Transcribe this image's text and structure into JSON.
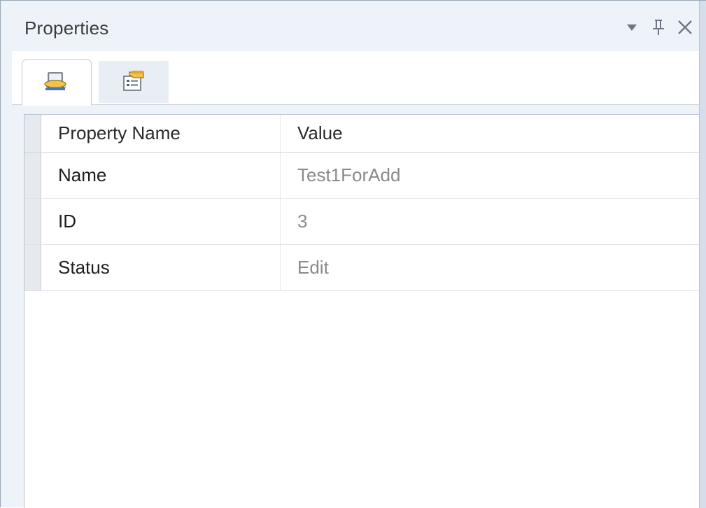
{
  "panel": {
    "title": "Properties",
    "controls": {
      "dropdown_icon": "chevron-down-icon",
      "pin_icon": "pin-icon",
      "close_icon": "close-icon"
    }
  },
  "tabs": [
    {
      "icon": "entity-properties-icon",
      "active": true
    },
    {
      "icon": "folder-properties-icon",
      "active": false
    }
  ],
  "grid": {
    "columns": [
      "Property Name",
      "Value"
    ],
    "rows": [
      {
        "name": "Name",
        "value": "Test1ForAdd"
      },
      {
        "name": "ID",
        "value": "3"
      },
      {
        "name": "Status",
        "value": "Edit"
      }
    ]
  },
  "colors": {
    "panel_bg": "#eef3f9",
    "value_text": "#8a8a8a",
    "name_text": "#1d1d1d"
  }
}
